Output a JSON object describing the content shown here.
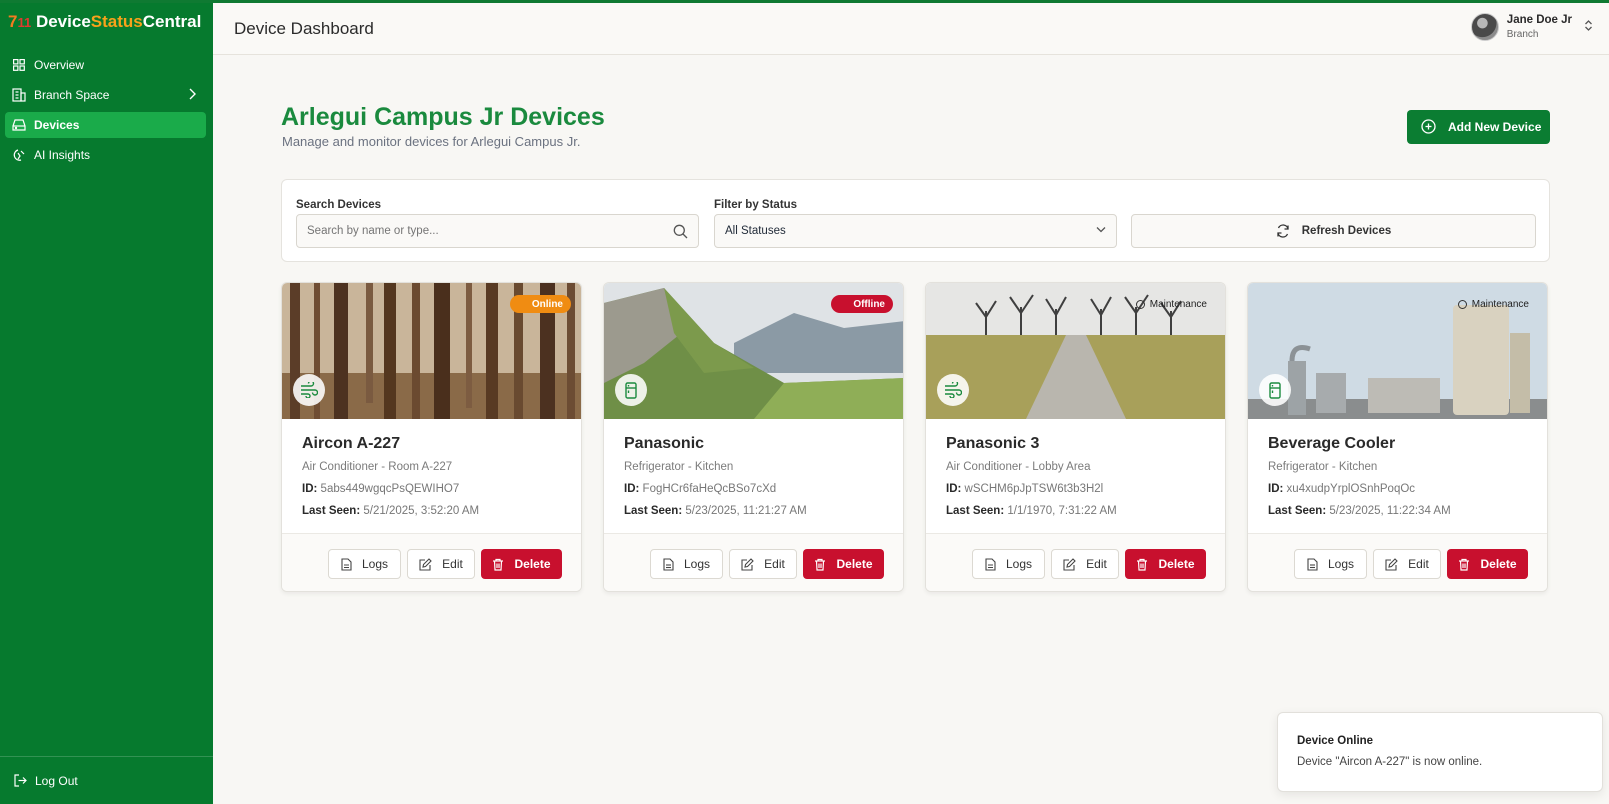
{
  "brand": {
    "seven": "7",
    "eleven": "11",
    "part1": "Device",
    "part2": "Status",
    "part3": "Central"
  },
  "sidebar": {
    "items": [
      {
        "label": "Overview",
        "icon": "grid-icon"
      },
      {
        "label": "Branch Space",
        "icon": "building-icon"
      },
      {
        "label": "Devices",
        "icon": "device-icon",
        "active": true
      },
      {
        "label": "AI Insights",
        "icon": "insights-icon"
      }
    ],
    "logout_label": "Log Out"
  },
  "header": {
    "title": "Device Dashboard"
  },
  "user": {
    "name": "Jane Doe Jr",
    "role": "Branch"
  },
  "page": {
    "title": "Arlegui Campus Jr Devices",
    "subtitle": "Manage and monitor devices for Arlegui Campus Jr.",
    "add_button": "Add New Device"
  },
  "filters": {
    "search_label": "Search Devices",
    "search_placeholder": "Search by name or type...",
    "status_label": "Filter by Status",
    "status_value": "All Statuses",
    "refresh_label": "Refresh Devices"
  },
  "devices": [
    {
      "name": "Aircon A-227",
      "type": "Air Conditioner - Room A-227",
      "id_label": "ID:",
      "id": "5abs449wgqcPsQEWIHO7",
      "seen_label": "Last Seen:",
      "last_seen": "5/21/2025, 3:52:20 AM",
      "status": "Online",
      "icon": "fan-icon"
    },
    {
      "name": "Panasonic",
      "type": "Refrigerator - Kitchen",
      "id_label": "ID:",
      "id": "FogHCr6faHeQcBSo7cXd",
      "seen_label": "Last Seen:",
      "last_seen": "5/23/2025, 11:21:27 AM",
      "status": "Offline",
      "icon": "fridge-icon"
    },
    {
      "name": "Panasonic 3",
      "type": "Air Conditioner - Lobby Area",
      "id_label": "ID:",
      "id": "wSCHM6pJpTSW6t3b3H2l",
      "seen_label": "Last Seen:",
      "last_seen": "1/1/1970, 7:31:22 AM",
      "status": "Maintenance",
      "icon": "fan-icon"
    },
    {
      "name": "Beverage Cooler",
      "type": "Refrigerator - Kitchen",
      "id_label": "ID:",
      "id": "xu4xudpYrplOSnhPoqOc",
      "seen_label": "Last Seen:",
      "last_seen": "5/23/2025, 11:22:34 AM",
      "status": "Maintenance",
      "icon": "fridge-icon"
    }
  ],
  "card_buttons": {
    "logs": "Logs",
    "edit": "Edit",
    "delete": "Delete"
  },
  "toast": {
    "title": "Device Online",
    "message": "Device \"Aircon A-227\" is now online."
  },
  "colors": {
    "sidebar": "#067a2e",
    "active": "#1aab4a",
    "primary": "#0b7d32",
    "danger": "#c8102e",
    "online": "#f08c12",
    "title": "#1a8a3e"
  }
}
